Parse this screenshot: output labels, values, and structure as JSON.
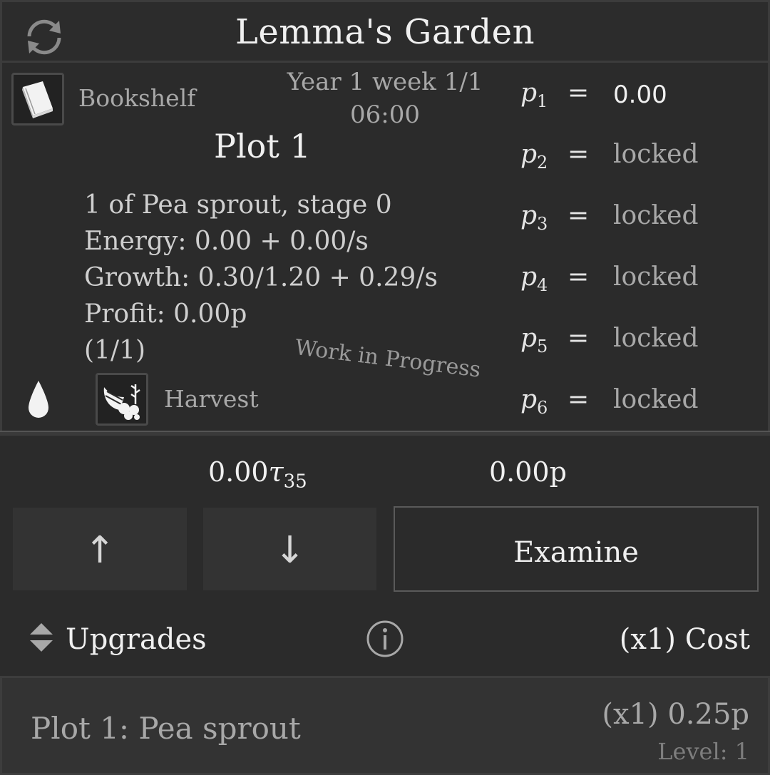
{
  "header": {
    "title": "Lemma's Garden",
    "switch_icon": "swap-arrows-icon"
  },
  "bookshelf": {
    "label": "Bookshelf",
    "icon": "book-icon"
  },
  "time": {
    "line1": "Year 1 week 1/1",
    "line2": "06:00"
  },
  "plot": {
    "title": "Plot 1",
    "crop": "1 of Pea sprout, stage 0",
    "energy": "Energy: 0.00  + 0.00/s",
    "growth": "Growth: 0.30/1.20  + 0.29/s",
    "profit": "Profit: 0.00p",
    "page": "(1/1)"
  },
  "wip_text": "Work in Progress",
  "water": {
    "icon": "water-drop-icon"
  },
  "harvest": {
    "label": "Harvest",
    "icon": "cornucopia-icon"
  },
  "variables": [
    {
      "name": "p",
      "sub": "1",
      "eq": "=",
      "value": "0.00",
      "state": "active"
    },
    {
      "name": "p",
      "sub": "2",
      "eq": "=",
      "value": "locked",
      "state": "locked"
    },
    {
      "name": "p",
      "sub": "3",
      "eq": "=",
      "value": "locked",
      "state": "locked"
    },
    {
      "name": "p",
      "sub": "4",
      "eq": "=",
      "value": "locked",
      "state": "locked"
    },
    {
      "name": "p",
      "sub": "5",
      "eq": "=",
      "value": "locked",
      "state": "locked"
    },
    {
      "name": "p",
      "sub": "6",
      "eq": "=",
      "value": "locked",
      "state": "locked"
    }
  ],
  "currency": {
    "tau_value": "0.00",
    "tau_symbol": "τ",
    "tau_sub": "35",
    "money": "0.00p"
  },
  "buttons": {
    "up": "↑",
    "down": "↓",
    "examine": "Examine"
  },
  "upgrades": {
    "label": "Upgrades",
    "cost_label": "(x1) Cost",
    "items": [
      {
        "name": "Plot 1: Pea sprout",
        "price": "(x1) 0.25p",
        "level": "Level: 1"
      }
    ]
  },
  "colors": {
    "background": "#2b2b2b",
    "panel_border": "#3c3c3c",
    "text_primary": "#f0f0f0",
    "text_secondary": "#a8a8a8"
  }
}
